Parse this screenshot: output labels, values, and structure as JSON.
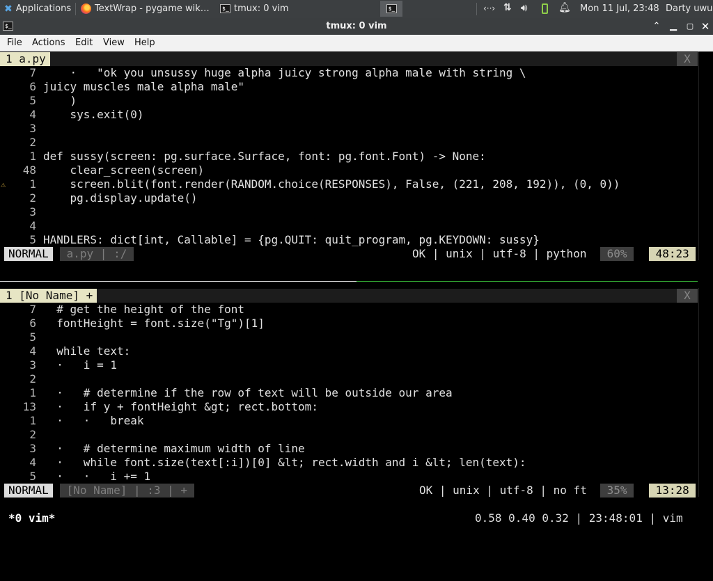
{
  "panel": {
    "applications": "Applications",
    "tasks": [
      {
        "label": "TextWrap - pygame wik…",
        "icon": "firefox-icon"
      },
      {
        "label": "tmux: 0 vim",
        "icon": "terminal-icon"
      }
    ],
    "clock": "Mon 11 Jul, 23:48",
    "user": "Darty uwu"
  },
  "window": {
    "title": "tmux: 0 vim"
  },
  "menu": [
    "File",
    "Actions",
    "Edit",
    "View",
    "Help"
  ],
  "top_pane": {
    "tab": "1 a.py",
    "close": "X",
    "lines": [
      {
        "n": "7",
        "c": "    ·   \"ok you unsussy huge alpha juicy strong alpha male with string \\"
      },
      {
        "n": "6",
        "c": "juicy muscles male alpha male\""
      },
      {
        "n": "5",
        "c": "    )"
      },
      {
        "n": "4",
        "c": "    sys.exit(0)"
      },
      {
        "n": "3",
        "c": ""
      },
      {
        "n": "2",
        "c": ""
      },
      {
        "n": "1",
        "c": "def sussy(screen: pg.surface.Surface, font: pg.font.Font) -> None:"
      },
      {
        "n": "48",
        "c": "    clear_screen(screen)"
      },
      {
        "n": "1",
        "c": "    screen.blit(font.render(RANDOM.choice(RESPONSES), False, (221, 208, 192)), (0, 0))",
        "warn": "⚠"
      },
      {
        "n": "2",
        "c": "    pg.display.update()"
      },
      {
        "n": "3",
        "c": ""
      },
      {
        "n": "4",
        "c": ""
      },
      {
        "n": "5",
        "c": "HANDLERS: dict[int, Callable] = {pg.QUIT: quit_program, pg.KEYDOWN: sussy}"
      }
    ],
    "status": {
      "mode": "NORMAL",
      "file": " a.py | :/ ",
      "info": "OK | unix | utf-8 | python",
      "percent": " 60% ",
      "position": " 48:23 "
    }
  },
  "bottom_pane": {
    "tab": "1 [No Name] +",
    "close": "X",
    "lines": [
      {
        "n": "7",
        "c": "  # get the height of the font"
      },
      {
        "n": "6",
        "c": "  fontHeight = font.size(\"Tg\")[1]"
      },
      {
        "n": "5",
        "c": ""
      },
      {
        "n": "4",
        "c": "  while text:"
      },
      {
        "n": "3",
        "c": "  ·   i = 1"
      },
      {
        "n": "2",
        "c": ""
      },
      {
        "n": "1",
        "c": "  ·   # determine if the row of text will be outside our area"
      },
      {
        "n": "13",
        "c": "  ·   if y + fontHeight &gt; rect.bottom:"
      },
      {
        "n": "1",
        "c": "  ·   ·   break"
      },
      {
        "n": "2",
        "c": ""
      },
      {
        "n": "3",
        "c": "  ·   # determine maximum width of line"
      },
      {
        "n": "4",
        "c": "  ·   while font.size(text[:i])[0] &lt; rect.width and i &lt; len(text):"
      },
      {
        "n": "5",
        "c": "  ·   ·   i += 1"
      }
    ],
    "status": {
      "mode": "NORMAL",
      "file": " [No Name] | :3 | + ",
      "info": "OK | unix | utf-8 | no ft",
      "percent": " 35% ",
      "position": " 13:28 "
    }
  },
  "tmux": {
    "window": "*0 vim*",
    "right": "0.58 0.40 0.32 | 23:48:01 | vim"
  }
}
